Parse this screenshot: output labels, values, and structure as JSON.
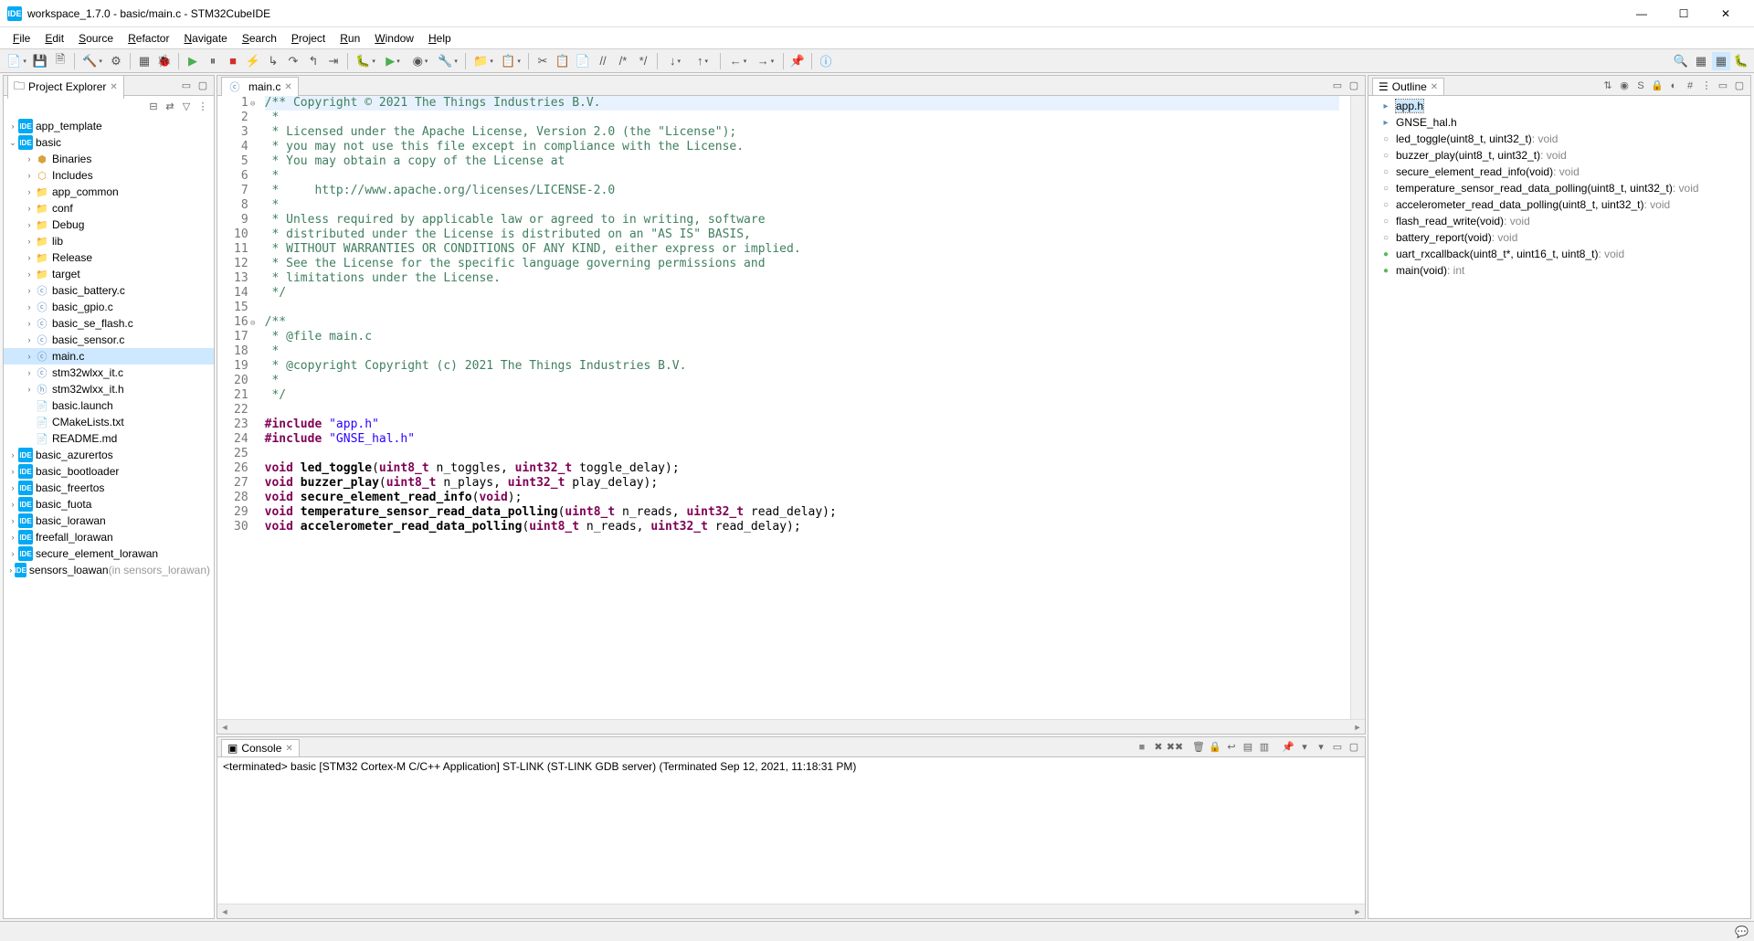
{
  "window": {
    "title": "workspace_1.7.0 - basic/main.c - STM32CubeIDE"
  },
  "menu": [
    "File",
    "Edit",
    "Source",
    "Refactor",
    "Navigate",
    "Search",
    "Project",
    "Run",
    "Window",
    "Help"
  ],
  "project_explorer": {
    "title": "Project Explorer",
    "tree": [
      {
        "d": 0,
        "exp": "›",
        "icon": "proj",
        "label": "app_template"
      },
      {
        "d": 0,
        "exp": "⌄",
        "icon": "proj",
        "label": "basic"
      },
      {
        "d": 1,
        "exp": "›",
        "icon": "bin",
        "label": "Binaries"
      },
      {
        "d": 1,
        "exp": "›",
        "icon": "inc",
        "label": "Includes"
      },
      {
        "d": 1,
        "exp": "›",
        "icon": "folder",
        "label": "app_common"
      },
      {
        "d": 1,
        "exp": "›",
        "icon": "folder",
        "label": "conf"
      },
      {
        "d": 1,
        "exp": "›",
        "icon": "folder",
        "label": "Debug"
      },
      {
        "d": 1,
        "exp": "›",
        "icon": "folder",
        "label": "lib"
      },
      {
        "d": 1,
        "exp": "›",
        "icon": "folder",
        "label": "Release"
      },
      {
        "d": 1,
        "exp": "›",
        "icon": "folder",
        "label": "target"
      },
      {
        "d": 1,
        "exp": "›",
        "icon": "cfile",
        "label": "basic_battery.c"
      },
      {
        "d": 1,
        "exp": "›",
        "icon": "cfile",
        "label": "basic_gpio.c"
      },
      {
        "d": 1,
        "exp": "›",
        "icon": "cfile",
        "label": "basic_se_flash.c"
      },
      {
        "d": 1,
        "exp": "›",
        "icon": "cfile",
        "label": "basic_sensor.c"
      },
      {
        "d": 1,
        "exp": "›",
        "icon": "cfile",
        "label": "main.c",
        "sel": true
      },
      {
        "d": 1,
        "exp": "›",
        "icon": "cfile",
        "label": "stm32wlxx_it.c"
      },
      {
        "d": 1,
        "exp": "›",
        "icon": "hfile",
        "label": "stm32wlxx_it.h"
      },
      {
        "d": 1,
        "exp": " ",
        "icon": "file",
        "label": "basic.launch"
      },
      {
        "d": 1,
        "exp": " ",
        "icon": "file",
        "label": "CMakeLists.txt"
      },
      {
        "d": 1,
        "exp": " ",
        "icon": "file",
        "label": "README.md"
      },
      {
        "d": 0,
        "exp": "›",
        "icon": "proj",
        "label": "basic_azurertos"
      },
      {
        "d": 0,
        "exp": "›",
        "icon": "proj",
        "label": "basic_bootloader"
      },
      {
        "d": 0,
        "exp": "›",
        "icon": "proj",
        "label": "basic_freertos"
      },
      {
        "d": 0,
        "exp": "›",
        "icon": "proj",
        "label": "basic_fuota"
      },
      {
        "d": 0,
        "exp": "›",
        "icon": "proj",
        "label": "basic_lorawan"
      },
      {
        "d": 0,
        "exp": "›",
        "icon": "proj",
        "label": "freefall_lorawan"
      },
      {
        "d": 0,
        "exp": "›",
        "icon": "proj",
        "label": "secure_element_lorawan"
      },
      {
        "d": 0,
        "exp": "›",
        "icon": "proj",
        "label": "sensors_loawan",
        "suffix": "(in sensors_lorawan)"
      }
    ]
  },
  "editor": {
    "tab": "main.c",
    "lines": [
      {
        "n": 1,
        "fold": "⊖",
        "seg": [
          {
            "c": "cmt",
            "t": "/** Copyright © 2021 The Things Industries B.V."
          }
        ]
      },
      {
        "n": 2,
        "seg": [
          {
            "c": "cmt",
            "t": " *"
          }
        ]
      },
      {
        "n": 3,
        "seg": [
          {
            "c": "cmt",
            "t": " * Licensed under the Apache License, Version 2.0 (the \"License\");"
          }
        ]
      },
      {
        "n": 4,
        "seg": [
          {
            "c": "cmt",
            "t": " * you may not use this file except in compliance with the License."
          }
        ]
      },
      {
        "n": 5,
        "seg": [
          {
            "c": "cmt",
            "t": " * You may obtain a copy of the License at"
          }
        ]
      },
      {
        "n": 6,
        "seg": [
          {
            "c": "cmt",
            "t": " *"
          }
        ]
      },
      {
        "n": 7,
        "seg": [
          {
            "c": "cmt",
            "t": " *     http://www.apache.org/licenses/LICENSE-2.0"
          }
        ]
      },
      {
        "n": 8,
        "seg": [
          {
            "c": "cmt",
            "t": " *"
          }
        ]
      },
      {
        "n": 9,
        "seg": [
          {
            "c": "cmt",
            "t": " * Unless required by applicable law or agreed to in writing, software"
          }
        ]
      },
      {
        "n": 10,
        "seg": [
          {
            "c": "cmt",
            "t": " * distributed under the License is distributed on an \"AS IS\" BASIS,"
          }
        ]
      },
      {
        "n": 11,
        "seg": [
          {
            "c": "cmt",
            "t": " * WITHOUT WARRANTIES OR CONDITIONS OF ANY KIND, either express or implied."
          }
        ]
      },
      {
        "n": 12,
        "seg": [
          {
            "c": "cmt",
            "t": " * See the License for the specific language governing permissions and"
          }
        ]
      },
      {
        "n": 13,
        "seg": [
          {
            "c": "cmt",
            "t": " * limitations under the License."
          }
        ]
      },
      {
        "n": 14,
        "seg": [
          {
            "c": "cmt",
            "t": " */"
          }
        ]
      },
      {
        "n": 15,
        "seg": [
          {
            "c": "",
            "t": ""
          }
        ]
      },
      {
        "n": 16,
        "fold": "⊖",
        "seg": [
          {
            "c": "cmt",
            "t": "/**"
          }
        ]
      },
      {
        "n": 17,
        "seg": [
          {
            "c": "cmt",
            "t": " * @file main.c"
          }
        ]
      },
      {
        "n": 18,
        "seg": [
          {
            "c": "cmt",
            "t": " *"
          }
        ]
      },
      {
        "n": 19,
        "seg": [
          {
            "c": "cmt",
            "t": " * @copyright Copyright (c) 2021 The Things Industries B.V."
          }
        ]
      },
      {
        "n": 20,
        "seg": [
          {
            "c": "cmt",
            "t": " *"
          }
        ]
      },
      {
        "n": 21,
        "seg": [
          {
            "c": "cmt",
            "t": " */"
          }
        ]
      },
      {
        "n": 22,
        "seg": [
          {
            "c": "",
            "t": ""
          }
        ]
      },
      {
        "n": 23,
        "seg": [
          {
            "c": "kw",
            "t": "#include "
          },
          {
            "c": "str",
            "t": "\"app.h\""
          }
        ]
      },
      {
        "n": 24,
        "seg": [
          {
            "c": "kw",
            "t": "#include "
          },
          {
            "c": "str",
            "t": "\"GNSE_hal.h\""
          }
        ]
      },
      {
        "n": 25,
        "seg": [
          {
            "c": "",
            "t": ""
          }
        ]
      },
      {
        "n": 26,
        "seg": [
          {
            "c": "kw",
            "t": "void"
          },
          {
            "c": "",
            "t": " "
          },
          {
            "c": "fn",
            "t": "led_toggle"
          },
          {
            "c": "",
            "t": "("
          },
          {
            "c": "kw",
            "t": "uint8_t"
          },
          {
            "c": "",
            "t": " n_toggles, "
          },
          {
            "c": "kw",
            "t": "uint32_t"
          },
          {
            "c": "",
            "t": " toggle_delay);"
          }
        ]
      },
      {
        "n": 27,
        "seg": [
          {
            "c": "kw",
            "t": "void"
          },
          {
            "c": "",
            "t": " "
          },
          {
            "c": "fn",
            "t": "buzzer_play"
          },
          {
            "c": "",
            "t": "("
          },
          {
            "c": "kw",
            "t": "uint8_t"
          },
          {
            "c": "",
            "t": " n_plays, "
          },
          {
            "c": "kw",
            "t": "uint32_t"
          },
          {
            "c": "",
            "t": " play_delay);"
          }
        ]
      },
      {
        "n": 28,
        "seg": [
          {
            "c": "kw",
            "t": "void"
          },
          {
            "c": "",
            "t": " "
          },
          {
            "c": "fn",
            "t": "secure_element_read_info"
          },
          {
            "c": "",
            "t": "("
          },
          {
            "c": "kw",
            "t": "void"
          },
          {
            "c": "",
            "t": ");"
          }
        ]
      },
      {
        "n": 29,
        "seg": [
          {
            "c": "kw",
            "t": "void"
          },
          {
            "c": "",
            "t": " "
          },
          {
            "c": "fn",
            "t": "temperature_sensor_read_data_polling"
          },
          {
            "c": "",
            "t": "("
          },
          {
            "c": "kw",
            "t": "uint8_t"
          },
          {
            "c": "",
            "t": " n_reads, "
          },
          {
            "c": "kw",
            "t": "uint32_t"
          },
          {
            "c": "",
            "t": " read_delay);"
          }
        ]
      },
      {
        "n": 30,
        "seg": [
          {
            "c": "kw",
            "t": "void"
          },
          {
            "c": "",
            "t": " "
          },
          {
            "c": "fn",
            "t": "accelerometer_read_data_polling"
          },
          {
            "c": "",
            "t": "("
          },
          {
            "c": "kw",
            "t": "uint8_t"
          },
          {
            "c": "",
            "t": " n_reads, "
          },
          {
            "c": "kw",
            "t": "uint32_t"
          },
          {
            "c": "",
            "t": " read_delay);"
          }
        ]
      }
    ]
  },
  "console": {
    "title": "Console",
    "status": "<terminated> basic [STM32 Cortex-M C/C++ Application] ST-LINK (ST-LINK GDB server) (Terminated Sep 12, 2021, 11:18:31 PM)"
  },
  "outline": {
    "title": "Outline",
    "items": [
      {
        "icon": "inc",
        "label": "app.h",
        "sel": true
      },
      {
        "icon": "inc",
        "label": "GNSE_hal.h"
      },
      {
        "icon": "func",
        "label": "led_toggle(uint8_t, uint32_t)",
        "ret": ": void"
      },
      {
        "icon": "func",
        "label": "buzzer_play(uint8_t, uint32_t)",
        "ret": ": void"
      },
      {
        "icon": "func",
        "label": "secure_element_read_info(void)",
        "ret": ": void"
      },
      {
        "icon": "func",
        "label": "temperature_sensor_read_data_polling(uint8_t, uint32_t)",
        "ret": ": void"
      },
      {
        "icon": "func",
        "label": "accelerometer_read_data_polling(uint8_t, uint32_t)",
        "ret": ": void"
      },
      {
        "icon": "func",
        "label": "flash_read_write(void)",
        "ret": ": void"
      },
      {
        "icon": "func",
        "label": "battery_report(void)",
        "ret": ": void"
      },
      {
        "icon": "g",
        "label": "uart_rxcallback(uint8_t*, uint16_t, uint8_t)",
        "ret": ": void"
      },
      {
        "icon": "g",
        "label": "main(void)",
        "ret": ": int"
      }
    ]
  }
}
